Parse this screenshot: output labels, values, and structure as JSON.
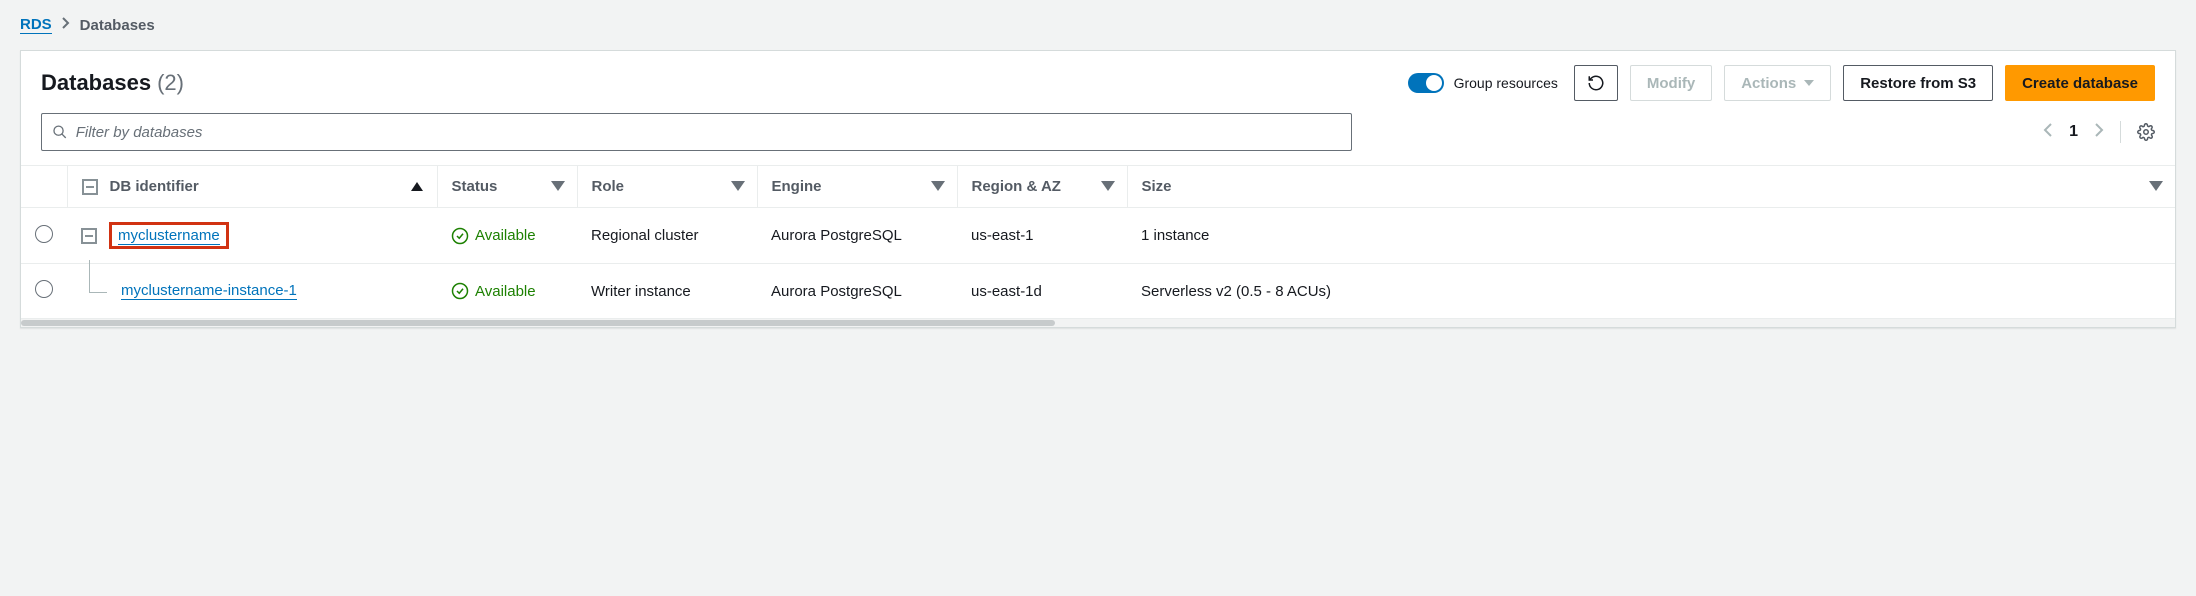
{
  "breadcrumb": {
    "root": "RDS",
    "current": "Databases"
  },
  "header": {
    "title": "Databases",
    "count": "(2)",
    "group_toggle_label": "Group resources",
    "modify_label": "Modify",
    "actions_label": "Actions",
    "restore_label": "Restore from S3",
    "create_label": "Create database"
  },
  "filter": {
    "placeholder": "Filter by databases"
  },
  "pager": {
    "page": "1"
  },
  "columns": {
    "identifier": "DB identifier",
    "status": "Status",
    "role": "Role",
    "engine": "Engine",
    "region": "Region & AZ",
    "size": "Size"
  },
  "rows": [
    {
      "identifier": "myclustername",
      "status": "Available",
      "role": "Regional cluster",
      "engine": "Aurora PostgreSQL",
      "region": "us-east-1",
      "size": "1 instance",
      "highlighted": true,
      "indent": 0
    },
    {
      "identifier": "myclustername-instance-1",
      "status": "Available",
      "role": "Writer instance",
      "engine": "Aurora PostgreSQL",
      "region": "us-east-1d",
      "size": "Serverless v2 (0.5 - 8 ACUs)",
      "highlighted": false,
      "indent": 1
    }
  ]
}
